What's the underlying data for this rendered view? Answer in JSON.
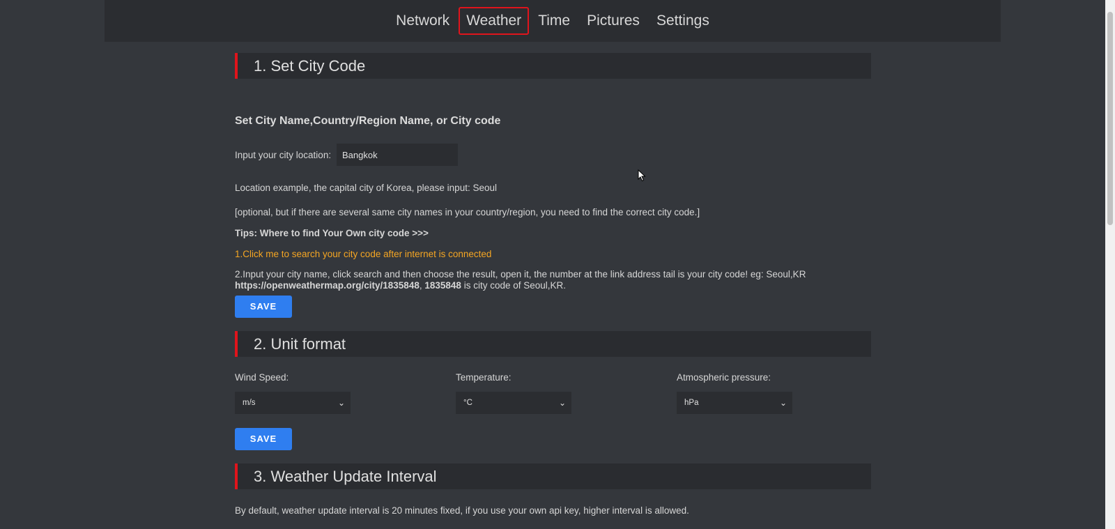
{
  "nav": {
    "items": [
      "Network",
      "Weather",
      "Time",
      "Pictures",
      "Settings"
    ],
    "active": "Weather"
  },
  "section1": {
    "title": "1. Set City Code",
    "subtitle": "Set City Name,Country/Region Name, or City code",
    "input_label": "Input your city location:",
    "input_value": "Bangkok",
    "example": "Location example, the capital city of Korea, please input: Seoul",
    "optional_note": "[optional, but if there are several same city names in your country/region, you need to find the correct city code.]",
    "tips": "Tips:  Where to find Your Own city code >>>",
    "tip1_link": "1.Click me to search your city code after internet is connected",
    "tip2_line1": "2.Input your city name, click search and then choose the result, open it, the number at the link address tail is your city code! eg: Seoul,KR",
    "tip2_url": "https://openweathermap.org/city/1835848",
    "tip2_sep": ",",
    "tip2_code": "1835848",
    "tip2_suffix": " is city code of Seoul,KR.",
    "save_label": "SAVE"
  },
  "section2": {
    "title": "2. Unit format",
    "wind_label": "Wind Speed:",
    "wind_value": "m/s",
    "temp_label": "Temperature:",
    "temp_value": "°C",
    "pressure_label": "Atmospheric pressure:",
    "pressure_value": "hPa",
    "save_label": "SAVE"
  },
  "section3": {
    "title": "3. Weather Update Interval",
    "description": "By default, weather update interval is 20 minutes fixed, if you use your own api key, higher interval is allowed."
  },
  "icons": {
    "dropdown": "chevron-down-icon",
    "pointer": "mouse-pointer-icon"
  },
  "colors": {
    "accent_red": "#e0141c",
    "link_orange": "#f5a623",
    "button_blue": "#2f7ef0",
    "background": "#34373c"
  }
}
